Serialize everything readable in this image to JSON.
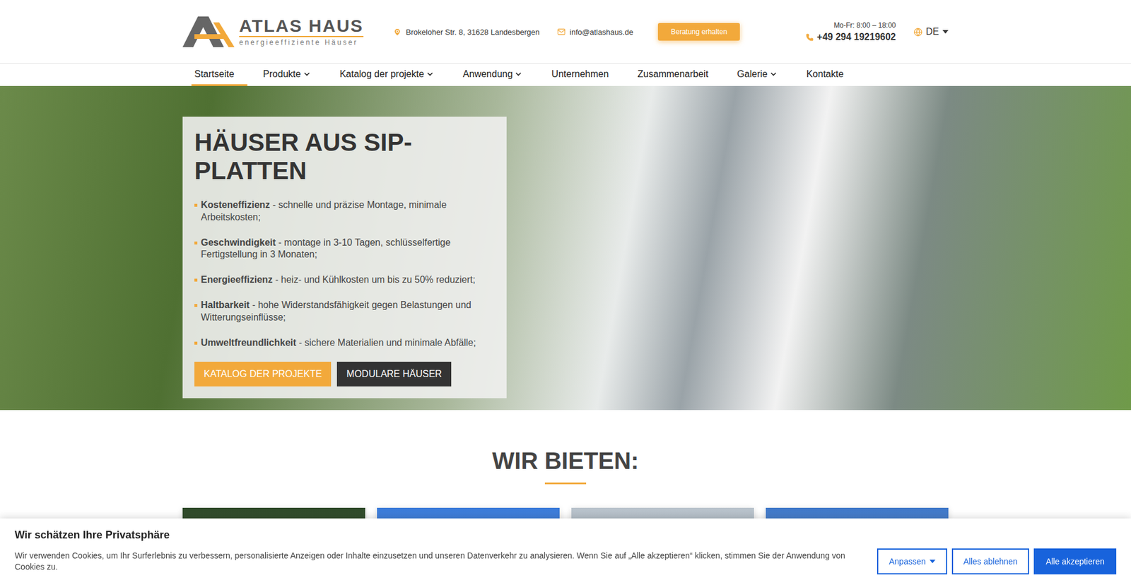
{
  "header": {
    "logo": {
      "name": "ATLAS HAUS",
      "tagline": "energieeffiziente Häuser"
    },
    "address": "Brokeloher Str. 8, 31628 Landesbergen",
    "email": "info@atlashaus.de",
    "cta": "Beratung erhalten",
    "hours": "Mo-Fr: 8:00 – 18:00",
    "phone": "+49 294 19219602",
    "language": "DE"
  },
  "nav": [
    {
      "label": "Startseite",
      "selected": true,
      "dropdown": false
    },
    {
      "label": "Produkte",
      "selected": false,
      "dropdown": true
    },
    {
      "label": "Katalog der projekte",
      "selected": false,
      "dropdown": true
    },
    {
      "label": "Anwendung",
      "selected": false,
      "dropdown": true
    },
    {
      "label": "Unternehmen",
      "selected": false,
      "dropdown": false
    },
    {
      "label": "Zusammenarbeit",
      "selected": false,
      "dropdown": false
    },
    {
      "label": "Galerie",
      "selected": false,
      "dropdown": true
    },
    {
      "label": "Kontakte",
      "selected": false,
      "dropdown": false
    }
  ],
  "hero": {
    "title": "HÄUSER AUS SIP-PLATTEN",
    "features": [
      {
        "bold": "Kosteneffizienz",
        "text": " - schnelle und präzise Montage, minimale Arbeitskosten;"
      },
      {
        "bold": "Geschwindigkeit",
        "text": " - montage in 3-10 Tagen, schlüsselfertige Fertigstellung in 3 Monaten;"
      },
      {
        "bold": "Energieeffizienz",
        "text": " - heiz- und Kühlkosten um bis zu 50% reduziert;"
      },
      {
        "bold": "Haltbarkeit",
        "text": " - hohe Widerstandsfähigkeit gegen Belastungen und Witterungseinflüsse;"
      },
      {
        "bold": "Umweltfreundlichkeit",
        "text": " - sichere Materialien und minimale Abfälle;"
      }
    ],
    "buttons": [
      {
        "label": "KATALOG DER PROJEKTE",
        "kind": "primary"
      },
      {
        "label": "MODULARE HÄUSER",
        "kind": "dark"
      }
    ]
  },
  "offer": {
    "title": "WIR BIETEN:",
    "cards": 4
  },
  "cookie": {
    "title": "Wir schätzen Ihre Privatsphäre",
    "text": "Wir verwenden Cookies, um Ihr Surferlebnis zu verbessern, personalisierte Anzeigen oder Inhalte einzusetzen und unseren Datenverkehr zu analysieren. Wenn Sie auf „Alle akzeptieren“ klicken, stimmen Sie der Anwendung von Cookies zu.",
    "buttons": [
      {
        "label": "Anpassen",
        "kind": "outline",
        "caret": true
      },
      {
        "label": "Alles ablehnen",
        "kind": "outline",
        "caret": false
      },
      {
        "label": "Alle akzeptieren",
        "kind": "filled",
        "caret": false
      }
    ]
  }
}
